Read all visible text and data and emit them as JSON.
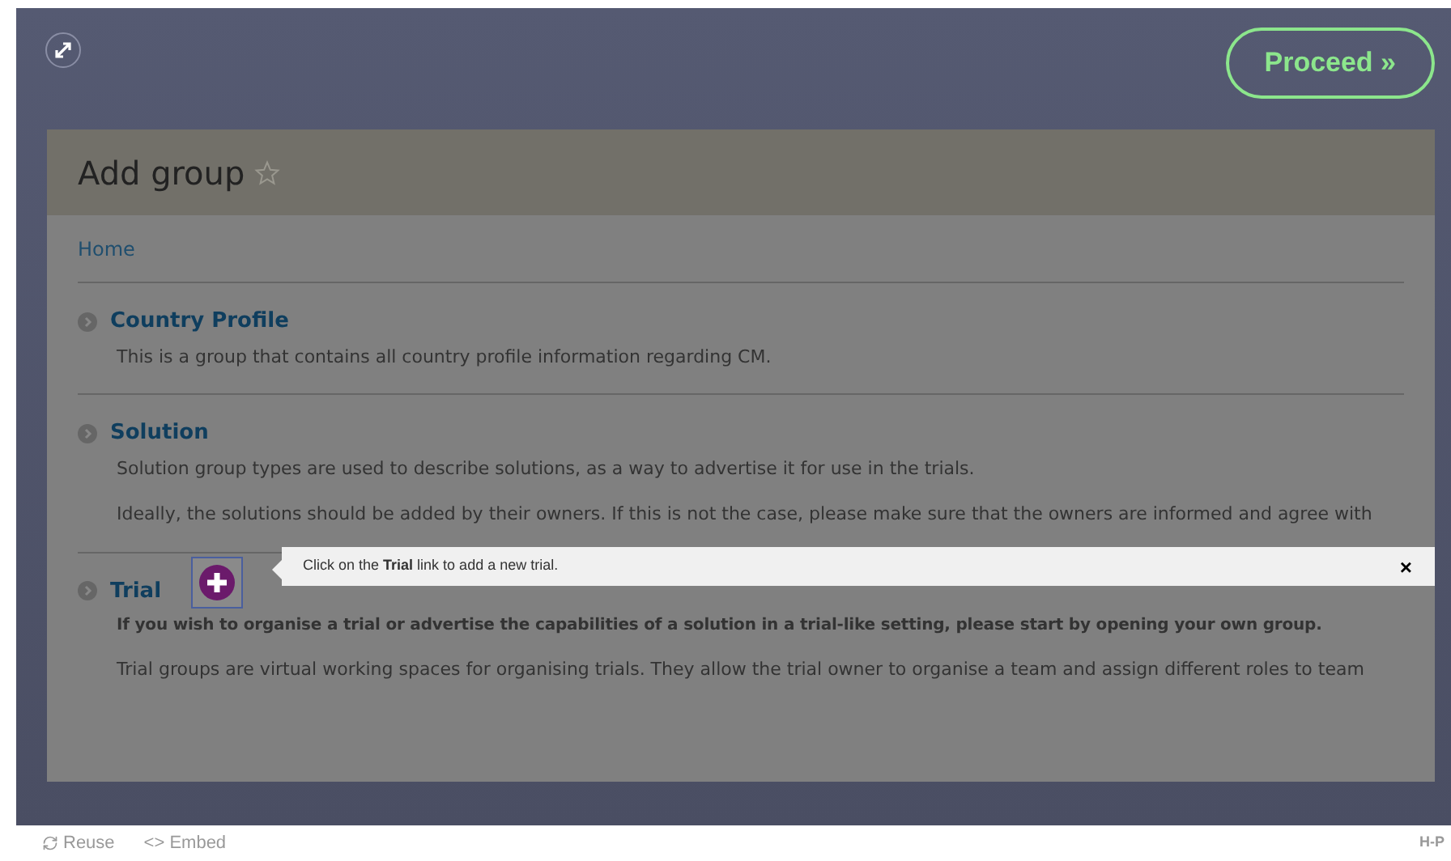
{
  "proceed_button": {
    "label": "Proceed »"
  },
  "page": {
    "title": "Add group",
    "breadcrumb": "Home",
    "groups": [
      {
        "title": "Country Profile",
        "paragraphs": [
          {
            "text": "This is a group that contains all country profile information regarding CM.",
            "bold": false
          }
        ]
      },
      {
        "title": "Solution",
        "paragraphs": [
          {
            "text": "Solution group types are used to describe solutions, as a way to advertise it for use in the trials.",
            "bold": false
          },
          {
            "text": "Ideally, the solutions should be added by their owners. If this is not the case, please make sure that the owners are informed and agree with",
            "bold": false
          }
        ]
      },
      {
        "title": "Trial",
        "paragraphs": [
          {
            "text": "If you wish to organise a trial or advertise the capabilities of a solution in a trial-like setting, please start by opening your own group.",
            "bold": true
          },
          {
            "text": "Trial groups are virtual working spaces for organising trials. They allow the trial owner to organise a team and assign different roles to team",
            "bold": false
          }
        ]
      }
    ]
  },
  "tooltip": {
    "text": "Click on the **Trial** link to add a new trial.",
    "close": "×"
  },
  "footer": {
    "reuse": "Reuse",
    "embed": "<> Embed",
    "logo": "H-P"
  }
}
